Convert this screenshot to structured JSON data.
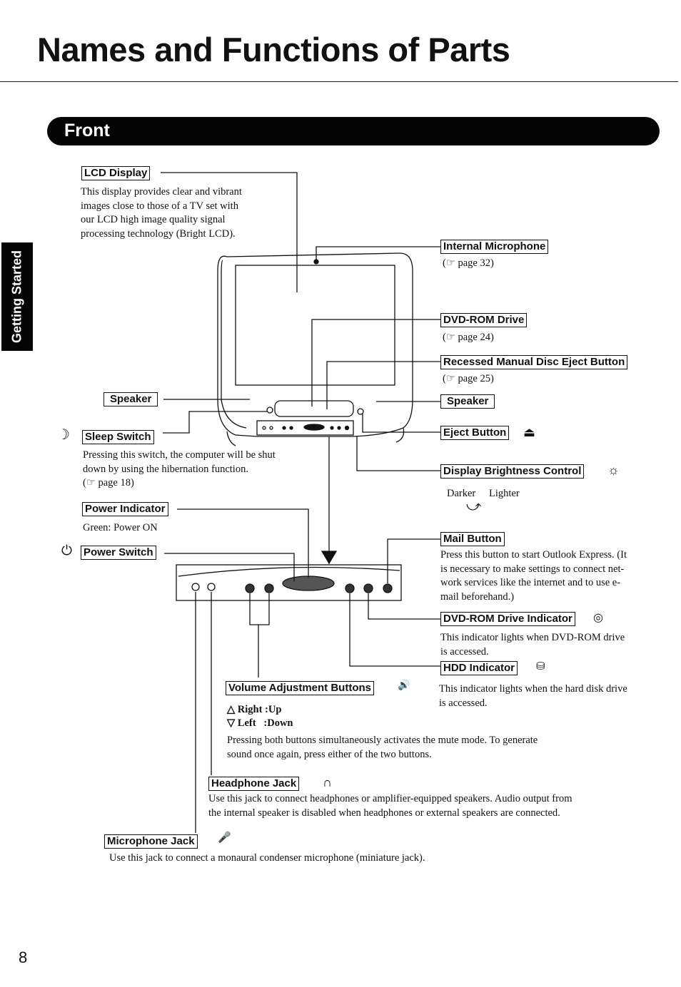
{
  "page": {
    "title": "Names and Functions of Parts",
    "section": "Front",
    "side_tab": "Getting Started",
    "page_number": "8"
  },
  "parts": {
    "lcd_display": {
      "label": "LCD Display",
      "desc": [
        "This display provides clear and vibrant",
        "images close to those of a TV set with",
        "our LCD high image quality signal",
        "processing technology (Bright LCD)."
      ]
    },
    "internal_microphone": {
      "label": "Internal Microphone",
      "ref": "(☞ page 32)"
    },
    "dvd_rom_drive": {
      "label": "DVD-ROM Drive",
      "ref": "(☞ page 24)"
    },
    "recessed_eject": {
      "label": "Recessed Manual Disc Eject Button",
      "ref": "(☞ page 25)"
    },
    "speaker_left": {
      "label": "Speaker"
    },
    "speaker_right": {
      "label": "Speaker"
    },
    "sleep_switch": {
      "label": "Sleep Switch",
      "icon": "moon-icon",
      "desc": [
        "Pressing this switch, the computer will be shut",
        "down by using the hibernation function."
      ],
      "ref": "(☞ page 18)"
    },
    "eject_button": {
      "label": "Eject Button",
      "icon": "eject-icon"
    },
    "display_brightness": {
      "label": "Display Brightness Control",
      "icon": "brightness-icon",
      "darker": "Darker",
      "lighter": "Lighter"
    },
    "power_indicator": {
      "label": "Power Indicator",
      "desc": "Green: Power ON"
    },
    "power_switch": {
      "label": "Power Switch",
      "icon": "power-icon"
    },
    "mail_button": {
      "label": "Mail Button",
      "desc": [
        "Press this button to start Outlook Express. (It",
        "is necessary to make settings to connect net-",
        "work services like the internet and to use e-",
        "mail beforehand.)"
      ]
    },
    "dvd_indicator": {
      "label": "DVD-ROM Drive Indicator",
      "icon": "disc-icon",
      "desc": [
        "This indicator lights when DVD-ROM drive",
        "is accessed."
      ]
    },
    "hdd_indicator": {
      "label": "HDD Indicator",
      "icon": "hdd-icon",
      "desc": [
        "This indicator lights when the hard disk drive",
        "is accessed."
      ]
    },
    "volume_buttons": {
      "label": "Volume Adjustment Buttons",
      "icon": "speaker-volume-icon",
      "up": "△ Right :Up",
      "down": "▽ Left   :Down",
      "desc": [
        "Pressing both buttons simultaneously activates the mute mode.  To generate",
        "sound once again, press either of the two buttons."
      ]
    },
    "headphone_jack": {
      "label": "Headphone Jack",
      "icon": "headphone-icon",
      "desc": [
        "Use this jack to connect  headphones or amplifier-equipped speakers.  Audio output from",
        "the internal speaker is disabled when headphones or external speakers are connected."
      ]
    },
    "microphone_jack": {
      "label": "Microphone Jack",
      "icon": "microphone-icon",
      "desc": "Use this jack to connect a monaural condenser microphone (miniature jack)."
    }
  },
  "icons": {
    "eject": "⏏",
    "moon": "☽",
    "power": "⏻",
    "brightness": "☼",
    "disc": "◎",
    "hdd": "⛁",
    "speaker": "🔊",
    "headphone": "∩",
    "microphone": "🎤",
    "curve_arrow": "⤻"
  }
}
